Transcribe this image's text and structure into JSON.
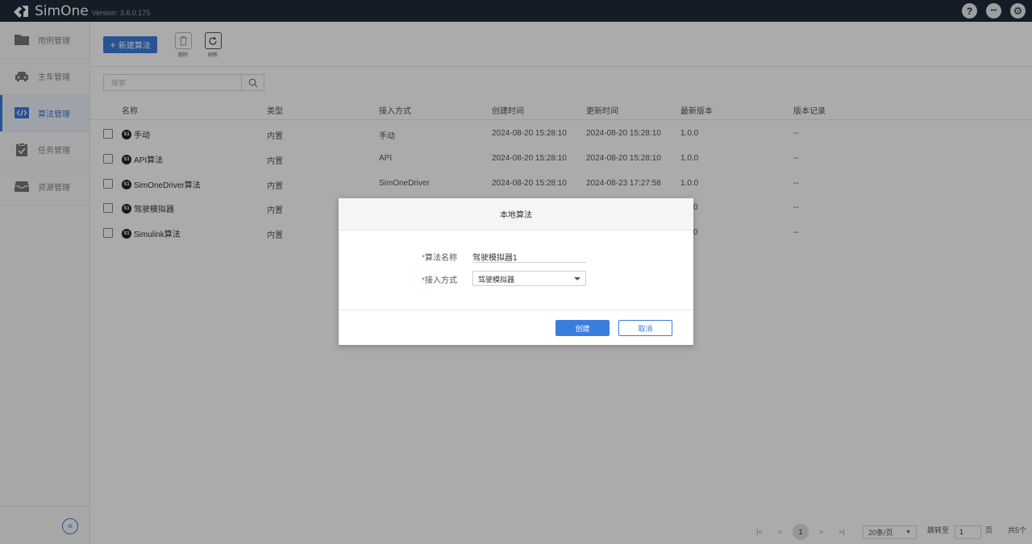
{
  "app": {
    "title": "SimOne",
    "version": "Version: 3.6.0.175",
    "top_icons": [
      "help-icon",
      "more-icon",
      "settings-icon"
    ],
    "top_icon_glyphs": [
      "?",
      "•••",
      "⚙"
    ]
  },
  "sidebar": {
    "items": [
      {
        "label": "用例管理",
        "icon": "folder-icon",
        "active": false
      },
      {
        "label": "主车管理",
        "icon": "car-icon",
        "active": false
      },
      {
        "label": "算法管理",
        "icon": "code-icon",
        "active": true
      },
      {
        "label": "任务管理",
        "icon": "clipboard-check-icon",
        "active": false
      },
      {
        "label": "资源管理",
        "icon": "inbox-icon",
        "active": false
      }
    ],
    "collapse_glyph": "«"
  },
  "toolbar": {
    "new_label": "新建算法",
    "delete_label": "删除",
    "refresh_label": "刷新"
  },
  "search": {
    "placeholder": "搜索"
  },
  "table": {
    "headers": [
      "名称",
      "类型",
      "接入方式",
      "创建时间",
      "更新时间",
      "最新版本",
      "版本记录"
    ],
    "rows": [
      {
        "name": "手动",
        "type": "内置",
        "access": "手动",
        "created": "2024-08-20 15:28:10",
        "updated": "2024-08-20 15:28:10",
        "version": "1.0.0",
        "history": "--"
      },
      {
        "name": "API算法",
        "type": "内置",
        "access": "API",
        "created": "2024-08-20 15:28:10",
        "updated": "2024-08-20 15:28:10",
        "version": "1.0.0",
        "history": "--"
      },
      {
        "name": "SimOneDriver算法",
        "type": "内置",
        "access": "SimOneDriver",
        "created": "2024-08-20 15:28:10",
        "updated": "2024-08-23 17:27:58",
        "version": "1.0.0",
        "history": "--"
      },
      {
        "name": "驾驶模拟器",
        "type": "内置",
        "access": "",
        "created": "",
        "updated": "",
        "version": "0",
        "history": "--"
      },
      {
        "name": "Simulink算法",
        "type": "内置",
        "access": "",
        "created": "",
        "updated": "",
        "version": "0",
        "history": "--"
      }
    ]
  },
  "pagination": {
    "current_page": "1",
    "page_size": "20条/页",
    "jump_label": "跳转至",
    "jump_value": "1",
    "page_unit": "页",
    "total": "共5个"
  },
  "dialog": {
    "title": "本地算法",
    "name_label": "算法名称",
    "name_value": "驾驶模拟器1",
    "access_label": "接入方式",
    "access_value": "驾驶模拟器",
    "required_mark": "*",
    "ok_label": "创建",
    "cancel_label": "取消"
  },
  "colors": {
    "topbar": "#1e2a3b",
    "accent": "#3b7ddd",
    "required": "#e04848"
  }
}
